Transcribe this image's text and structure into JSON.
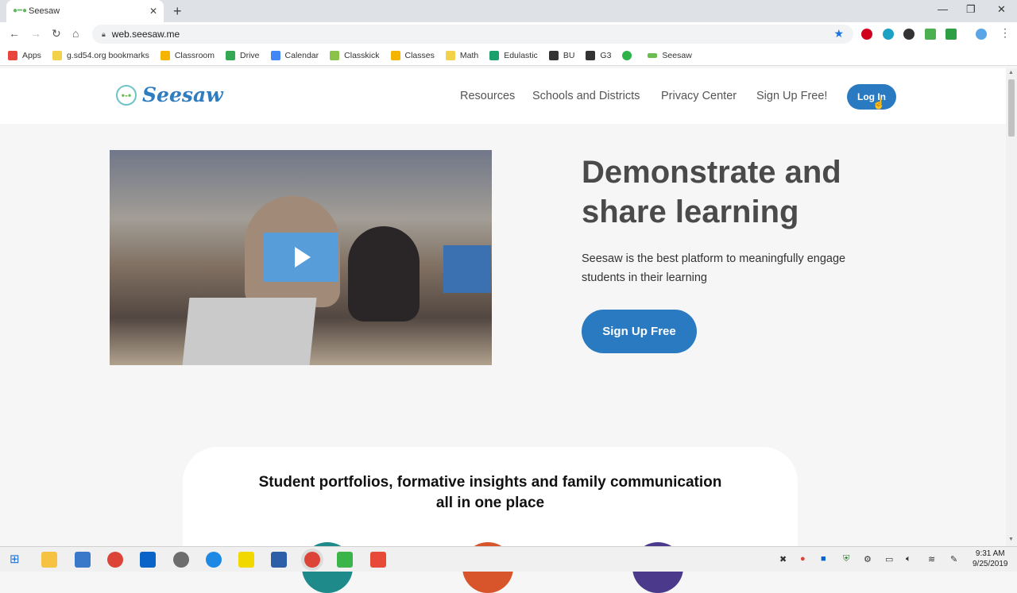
{
  "browser": {
    "tab_title": "Seesaw",
    "tab_close": "✕",
    "new_tab": "+",
    "url": "web.seesaw.me",
    "bookmarks": [
      {
        "label": "Apps",
        "icon": "apps-grid-icon",
        "color": "#e8453c"
      },
      {
        "label": "g.sd54.org bookmarks",
        "icon": "folder-icon",
        "color": "#f2d14b"
      },
      {
        "label": "Classroom",
        "icon": "classroom-icon",
        "color": "#f4b400"
      },
      {
        "label": "Drive",
        "icon": "drive-icon",
        "color": "#34a853"
      },
      {
        "label": "Calendar",
        "icon": "calendar-icon",
        "color": "#4285f4"
      },
      {
        "label": "Classkick",
        "icon": "classkick-icon",
        "color": "#8bc34a"
      },
      {
        "label": "Classes",
        "icon": "classes-icon",
        "color": "#f4b400"
      },
      {
        "label": "Math",
        "icon": "folder-icon",
        "color": "#f2d14b"
      },
      {
        "label": "Edulastic",
        "icon": "edulastic-icon",
        "color": "#1aa06d"
      },
      {
        "label": "BU",
        "icon": "flag-icon",
        "color": "#333333"
      },
      {
        "label": "G3",
        "icon": "flag-icon",
        "color": "#333333"
      },
      {
        "label": "",
        "icon": "plus-circle-icon",
        "color": "#2db34a"
      },
      {
        "label": "Seesaw",
        "icon": "seesaw-icon",
        "color": "#6cbd4f"
      }
    ]
  },
  "site": {
    "logo_text": "Seesaw",
    "nav": [
      "Resources",
      "Schools and Districts",
      "Privacy Center",
      "Sign Up Free!"
    ],
    "login": "Log In",
    "brand_color": "#2a7ac2",
    "headline": "Demonstrate and share learning",
    "subtext": "Seesaw is the best platform to meaningfully engage students in their learning",
    "cta": "Sign Up Free",
    "card_title_line1": "Student portfolios, formative insights and family communication",
    "card_title_line2": "all in one place"
  },
  "taskbar": {
    "time": "9:31 AM",
    "date": "9/25/2019"
  }
}
